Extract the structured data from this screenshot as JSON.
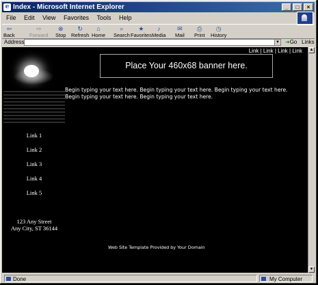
{
  "window": {
    "title": "Index - Microsoft Internet Explorer",
    "controls": [
      "_",
      "□",
      "×"
    ]
  },
  "menu": [
    "File",
    "Edit",
    "View",
    "Favorites",
    "Tools",
    "Help"
  ],
  "toolbar": [
    {
      "label": "Back",
      "icon": "back-arrow-icon",
      "glyph": "⇦",
      "disabled": false
    },
    {
      "label": "Forward",
      "icon": "forward-arrow-icon",
      "glyph": "⇨",
      "disabled": true
    },
    {
      "label": "Stop",
      "icon": "stop-icon",
      "glyph": "⊗",
      "disabled": false
    },
    {
      "label": "Refresh",
      "icon": "refresh-icon",
      "glyph": "↻",
      "disabled": false
    },
    {
      "label": "Home",
      "icon": "home-icon",
      "glyph": "⌂",
      "disabled": false
    },
    {
      "label": "Search",
      "icon": "search-icon",
      "glyph": "⌕",
      "disabled": false
    },
    {
      "label": "Favorites",
      "icon": "favorites-icon",
      "glyph": "★",
      "disabled": false
    },
    {
      "label": "Media",
      "icon": "media-icon",
      "glyph": "♪",
      "disabled": false
    },
    {
      "label": "Mail",
      "icon": "mail-icon",
      "glyph": "✉",
      "disabled": false
    },
    {
      "label": "Print",
      "icon": "print-icon",
      "glyph": "⎙",
      "disabled": false
    },
    {
      "label": "History",
      "icon": "history-icon",
      "glyph": "◷",
      "disabled": false
    }
  ],
  "address": {
    "label": "Address",
    "value": "",
    "go": "Go",
    "links": "Links"
  },
  "page": {
    "top_links": "Link | Link | Link | Link",
    "banner": "Place Your 460x68 banner here.",
    "body_text": "Begin typing your text here. Begin typing your text here. Begin typing your text here. Begin typing your text here. Begin typing your text here.",
    "side_links": [
      "Link 1",
      "Link 2",
      "Link 3",
      "Link 4",
      "Link 5"
    ],
    "address_line1": "123 Any Street",
    "address_line2": "Any City, ST 36144",
    "footer": "Web Site Template Provided by Your Domain"
  },
  "status": {
    "left": "Done",
    "right": "My Computer"
  },
  "colors": {
    "titlebar": "#0a246a",
    "chrome": "#d4d0c8",
    "page_bg": "#000000",
    "page_text": "#ffffff"
  }
}
